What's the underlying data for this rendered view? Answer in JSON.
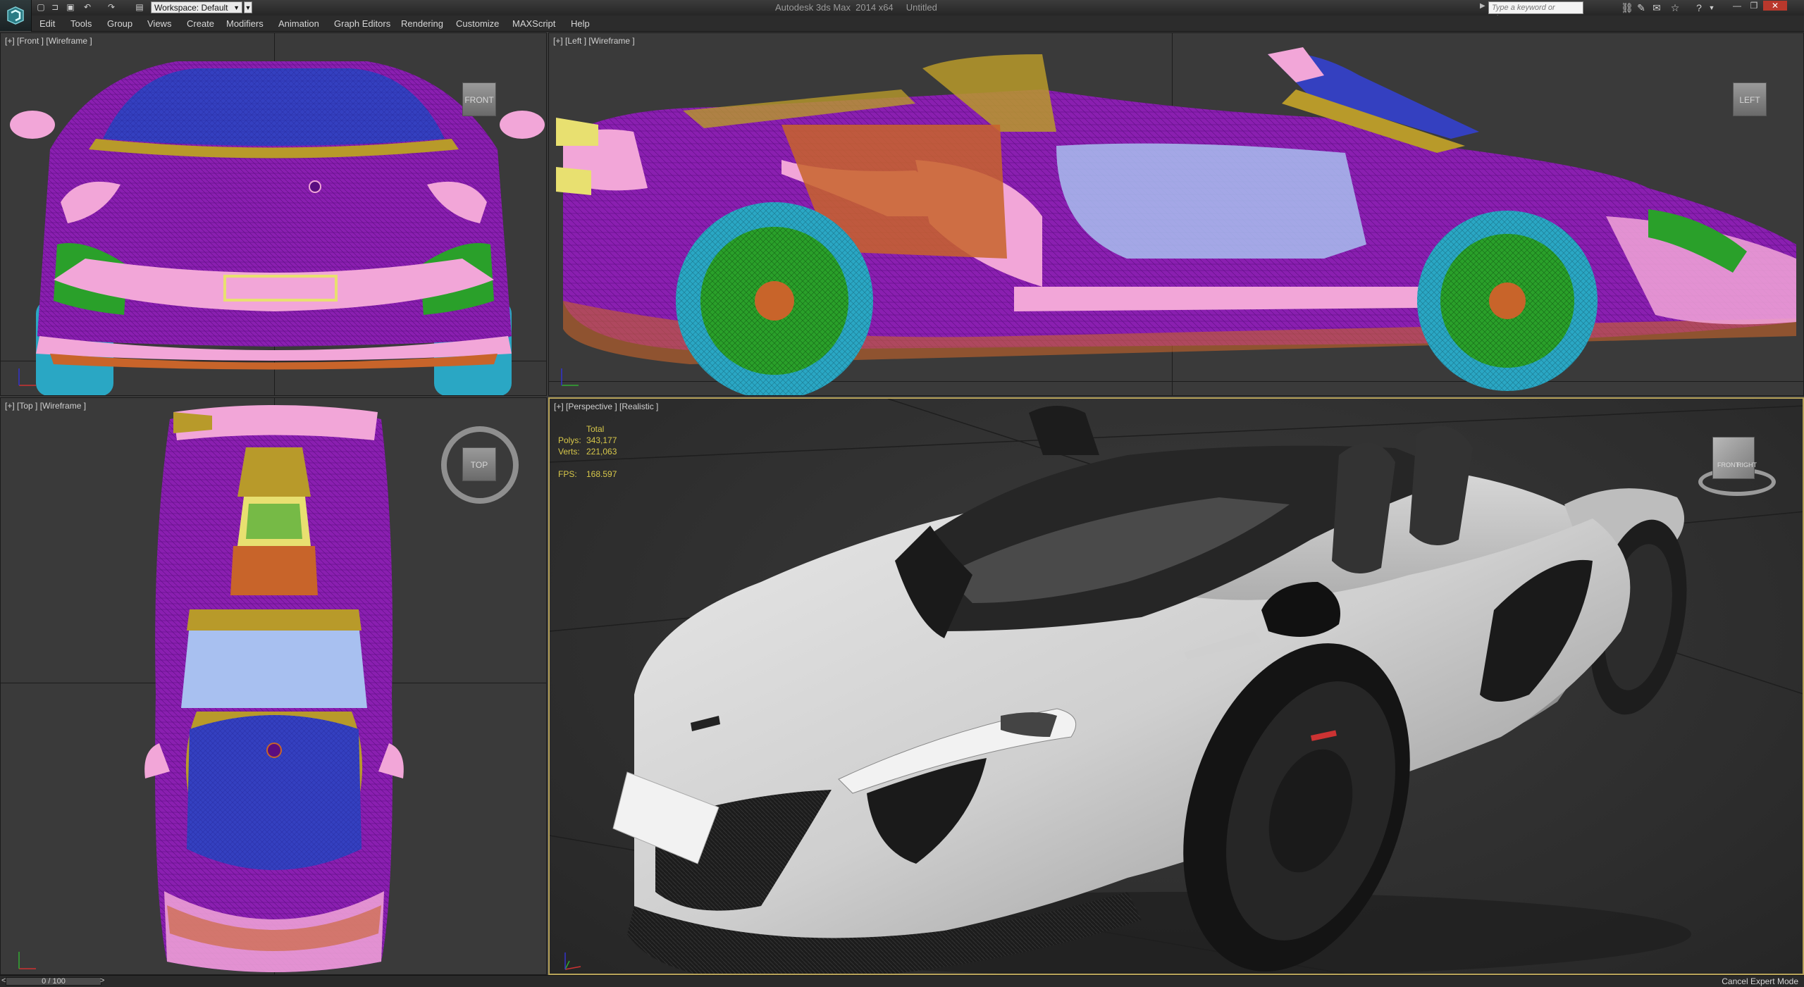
{
  "titlebar": {
    "workspace": "Workspace: Default",
    "title": "Autodesk 3ds Max  2014 x64     Untitled",
    "search_placeholder": "Type a keyword or phrase"
  },
  "menu": [
    {
      "label": "Edit"
    },
    {
      "label": "Tools"
    },
    {
      "label": "Group"
    },
    {
      "label": "Views"
    },
    {
      "label": "Create"
    },
    {
      "label": "Modifiers"
    },
    {
      "label": "Animation"
    },
    {
      "label": "Graph Editors"
    },
    {
      "label": "Rendering"
    },
    {
      "label": "Customize"
    },
    {
      "label": "MAXScript"
    },
    {
      "label": "Help"
    }
  ],
  "viewports": {
    "front": {
      "label": "[+] [Front ] [Wireframe ]",
      "cube": "FRONT"
    },
    "left": {
      "label": "[+] [Left ] [Wireframe ]",
      "cube": "LEFT"
    },
    "top": {
      "label": "[+] [Top ] [Wireframe ]",
      "cube": "TOP"
    },
    "perspective": {
      "label": "[+] [Perspective ] [Realistic ]",
      "cube_front": "FRONT",
      "cube_right": "RIGHT"
    }
  },
  "stats": {
    "header": "Total",
    "polys_label": "Polys:",
    "polys_value": "343,177",
    "verts_label": "Verts:",
    "verts_value": "221,063",
    "fps_label": "FPS:",
    "fps_value": "168.597"
  },
  "statusbar": {
    "frame": "0 / 100",
    "prev": "<",
    "next": ">",
    "cancel_expert": "Cancel Expert Mode"
  },
  "colors": {
    "active_border": "#b7a35a",
    "stats_text": "#d8c84a",
    "wire_purple": "#8a1fb0",
    "wire_pink": "#f2a6d8",
    "wire_green": "#2aa02a",
    "wire_cyan": "#3ab4d4",
    "wire_orange": "#c8642a",
    "wire_gold": "#b89a2a",
    "wire_blue": "#3440c0",
    "wire_lightblue": "#a8c0f0"
  }
}
